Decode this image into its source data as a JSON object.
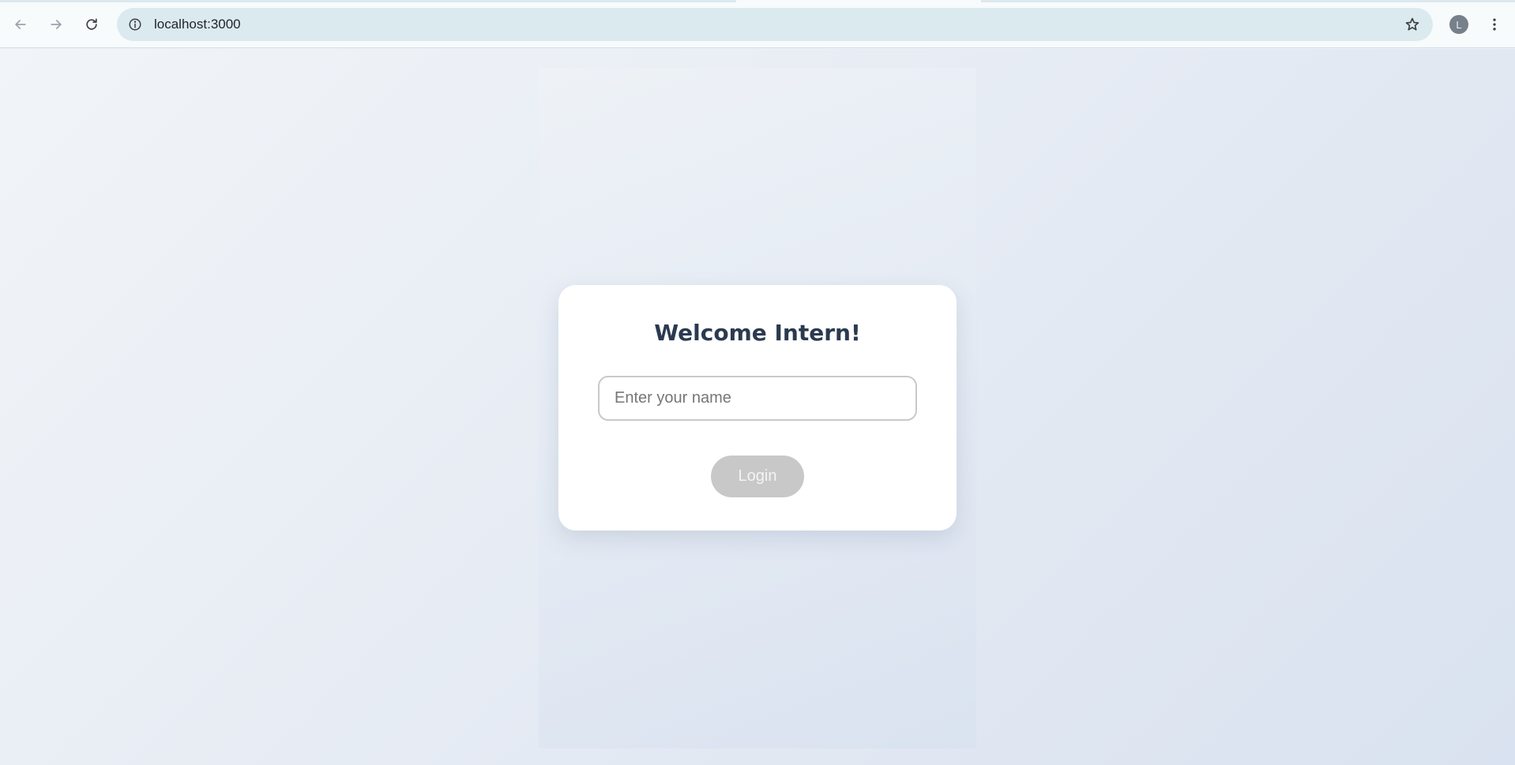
{
  "browser": {
    "url": "localhost:3000",
    "profile_initial": "L",
    "icons": {
      "back": "arrow-left-icon",
      "forward": "arrow-right-icon",
      "reload": "reload-icon",
      "site_info": "info-icon",
      "bookmark": "star-icon",
      "menu": "kebab-menu-icon"
    }
  },
  "login": {
    "title": "Welcome Intern!",
    "name_placeholder": "Enter your name",
    "name_value": "",
    "login_label": "Login",
    "login_enabled": false
  },
  "colors": {
    "title_text": "#2b3a4f",
    "button_disabled_bg": "#c8c8c8",
    "card_bg": "#ffffff",
    "omnibox_bg": "#dbeaee"
  }
}
